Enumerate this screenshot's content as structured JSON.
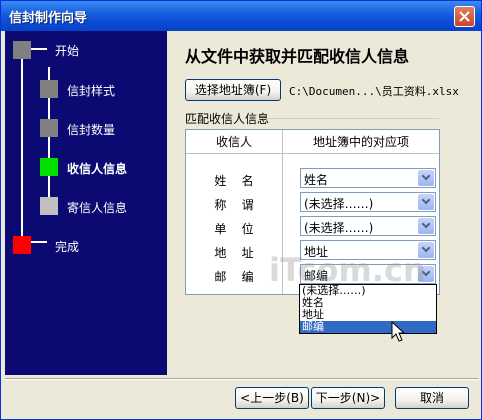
{
  "window": {
    "title": "信封制作向导"
  },
  "nav": {
    "steps": [
      {
        "label": "开始",
        "color": "#808080"
      },
      {
        "label": "信封样式",
        "color": "#808080"
      },
      {
        "label": "信封数量",
        "color": "#808080"
      },
      {
        "label": "收信人信息",
        "color": "#00e000",
        "current": true
      },
      {
        "label": "寄信人信息",
        "color": "#c0c0c0"
      },
      {
        "label": "完成",
        "color": "#ff0000"
      }
    ]
  },
  "main": {
    "heading": "从文件中获取并匹配收信人信息",
    "choose_button": "选择地址簿(F)",
    "file_path": "C:\\Documen...\\员工资料.xlsx",
    "group_label": "匹配收信人信息",
    "columns": [
      "收信人",
      "地址簿中的对应项"
    ],
    "fields": [
      {
        "label": "姓    名",
        "value": "姓名"
      },
      {
        "label": "称    谓",
        "value": "(未选择……)"
      },
      {
        "label": "单    位",
        "value": "(未选择……)"
      },
      {
        "label": "地    址",
        "value": "地址"
      },
      {
        "label": "邮    编",
        "value": "邮编"
      }
    ],
    "dropdown_options": [
      "(未选择……)",
      "姓名",
      "地址",
      "邮编"
    ],
    "dropdown_selected": "邮编"
  },
  "watermark": "iTcom.cn",
  "buttons": {
    "back": "<上一步(B)",
    "next": "下一步(N)>",
    "cancel": "取消"
  }
}
